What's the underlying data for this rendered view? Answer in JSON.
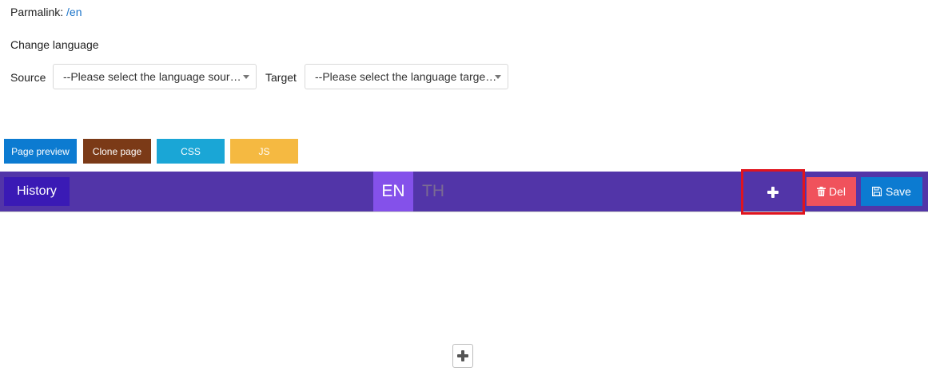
{
  "permalink": {
    "label": "Parmalink:",
    "value": "/en"
  },
  "change_language": {
    "heading": "Change language",
    "source_label": "Source",
    "source_value": "--Please select the language sour…",
    "target_label": "Target",
    "target_value": "--Please select the language targe…"
  },
  "actions": {
    "page_preview": "Page preview",
    "clone_page": "Clone page",
    "css": "CSS",
    "js": "JS"
  },
  "toolbar": {
    "history": "History",
    "languages": [
      "EN",
      "TH"
    ],
    "active_language": "EN",
    "del": "Del",
    "save": "Save"
  },
  "icons": {
    "add_top": "plus-icon",
    "del": "trash-icon",
    "save": "floppy-disk-icon",
    "add_bottom": "plus-icon"
  },
  "colors": {
    "toolbar": "#5235a8",
    "history": "#3a1ab5",
    "active_lang": "#8451ea",
    "page_preview": "#0c7bd1",
    "clone_page": "#7b3a17",
    "css": "#1aa6d6",
    "js": "#f5b941",
    "del": "#f0525c",
    "save": "#0c7bd1",
    "highlight": "#e0141e"
  }
}
